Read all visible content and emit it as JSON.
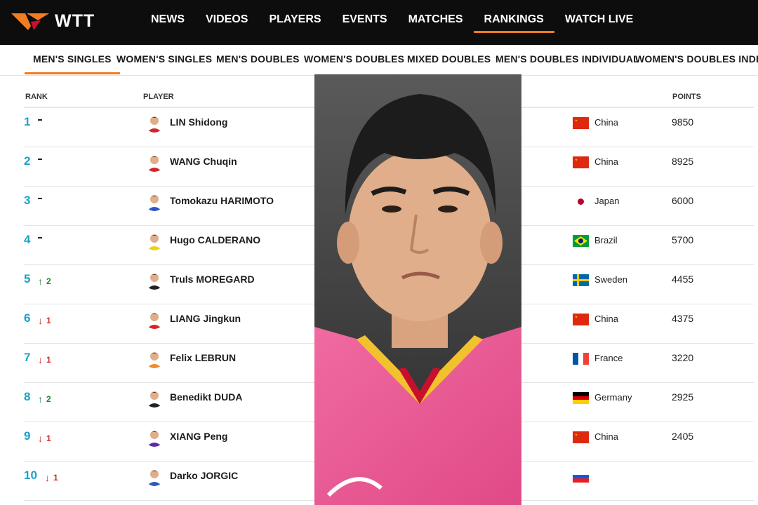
{
  "brand": {
    "name": "WTT",
    "accent": "#f47c20"
  },
  "nav": [
    {
      "label": "NEWS",
      "active": false
    },
    {
      "label": "VIDEOS",
      "active": false
    },
    {
      "label": "PLAYERS",
      "active": false
    },
    {
      "label": "EVENTS",
      "active": false
    },
    {
      "label": "MATCHES",
      "active": false
    },
    {
      "label": "RANKINGS",
      "active": true
    },
    {
      "label": "WATCH LIVE",
      "active": false
    }
  ],
  "subtabs": [
    {
      "label": "MEN'S SINGLES",
      "active": true
    },
    {
      "label": "WOMEN'S SINGLES",
      "active": false
    },
    {
      "label": "MEN'S DOUBLES",
      "active": false
    },
    {
      "label": "WOMEN'S DOUBLES",
      "active": false
    },
    {
      "label": "MIXED DOUBLES",
      "active": false
    },
    {
      "label": "MEN'S DOUBLES INDIVIDUAL",
      "active": false
    },
    {
      "label": "WOMEN'S DOUBLES INDIVIDUAL",
      "active": false
    }
  ],
  "table": {
    "headers": {
      "rank": "RANK",
      "player": "PLAYER",
      "points": "POINTS"
    },
    "rows": [
      {
        "rank": "1",
        "trend": "same",
        "change": "",
        "name": "LIN Shidong",
        "country": "China",
        "flag": "china",
        "points": "9850"
      },
      {
        "rank": "2",
        "trend": "same",
        "change": "",
        "name": "WANG Chuqin",
        "country": "China",
        "flag": "china",
        "points": "8925"
      },
      {
        "rank": "3",
        "trend": "same",
        "change": "",
        "name": "Tomokazu HARIMOTO",
        "country": "Japan",
        "flag": "japan",
        "points": "6000"
      },
      {
        "rank": "4",
        "trend": "same",
        "change": "",
        "name": "Hugo CALDERANO",
        "country": "Brazil",
        "flag": "brazil",
        "points": "5700"
      },
      {
        "rank": "5",
        "trend": "up",
        "change": "2",
        "name": "Truls MOREGARD",
        "country": "Sweden",
        "flag": "sweden",
        "points": "4455"
      },
      {
        "rank": "6",
        "trend": "down",
        "change": "1",
        "name": "LIANG Jingkun",
        "country": "China",
        "flag": "china",
        "points": "4375"
      },
      {
        "rank": "7",
        "trend": "down",
        "change": "1",
        "name": "Felix LEBRUN",
        "country": "France",
        "flag": "france",
        "points": "3220"
      },
      {
        "rank": "8",
        "trend": "up",
        "change": "2",
        "name": "Benedikt DUDA",
        "country": "Germany",
        "flag": "germany",
        "points": "2925"
      },
      {
        "rank": "9",
        "trend": "down",
        "change": "1",
        "name": "XIANG Peng",
        "country": "China",
        "flag": "china",
        "points": "2405"
      },
      {
        "rank": "10",
        "trend": "down",
        "change": "1",
        "name": "Darko JORGIC",
        "country": "",
        "flag": "slovenia",
        "points": ""
      }
    ]
  },
  "colors": {
    "rank": "#1aa2c9",
    "up": "#1a8a34",
    "down": "#d42a2a",
    "topbar": "#0d0d0d"
  }
}
